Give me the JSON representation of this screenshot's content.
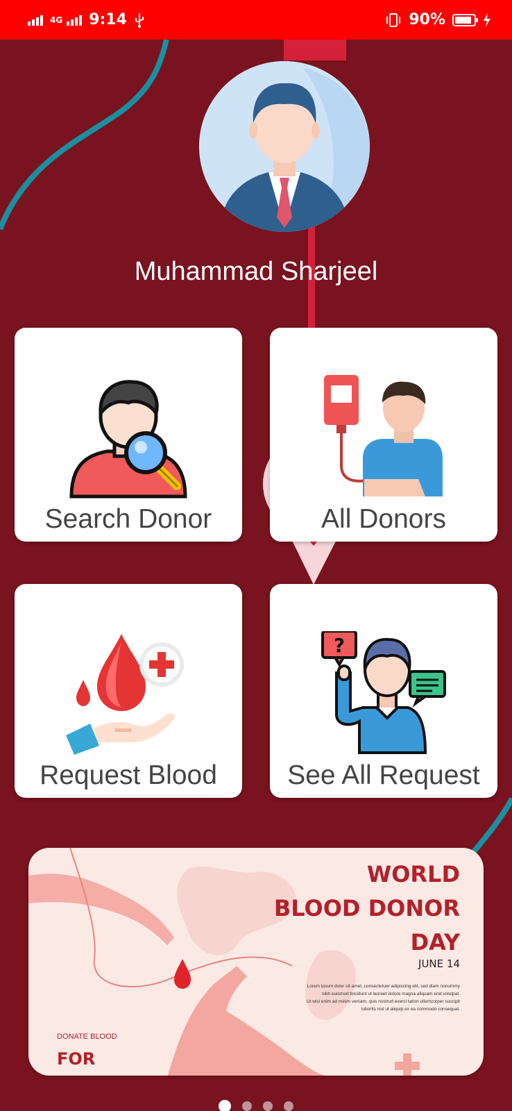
{
  "status_bar": {
    "network": "4G",
    "time": "9:14",
    "battery": "90%",
    "battery_level": 0.9,
    "icons": [
      "signal-icon",
      "usb-icon",
      "vibrate-icon",
      "battery-icon",
      "charging-icon"
    ]
  },
  "theme": {
    "background": "#78131f",
    "status_bar": "#ff0000",
    "accent_teal": "#1a8fa0",
    "card": "#ffffff",
    "banner_red": "#b3202a"
  },
  "profile": {
    "name": "Muhammad Sharjeel",
    "avatar_icon": "businessman-avatar-icon"
  },
  "cards": [
    {
      "label": "Search Donor",
      "icon": "search-donor-icon"
    },
    {
      "label": "All Donors",
      "icon": "blood-transfusion-icon"
    },
    {
      "label": "Request Blood",
      "icon": "blood-drop-hand-icon"
    },
    {
      "label": "See All Request",
      "icon": "question-person-icon"
    }
  ],
  "banner": {
    "title_lines": [
      "WORLD",
      "BLOOD DONOR",
      "DAY"
    ],
    "date": "JUNE 14",
    "body_lines": [
      "Lorem ipsum dolor sit amet, consectetuer adipiscing elit, sed diam nonummy",
      "nibh euismod tincidunt ut laoreet dolore magna aliquam erat volutpat.",
      "Ut wisi enim ad minim veniam, quis nostrud exerci tation ullamcorper suscipit",
      "lobortis nisl ut aliquip ex ea commodo consequat."
    ],
    "donate_text": "DONATE BLOOD",
    "tagline": "FOR"
  },
  "pager": {
    "count": 4,
    "active_index": 0
  }
}
